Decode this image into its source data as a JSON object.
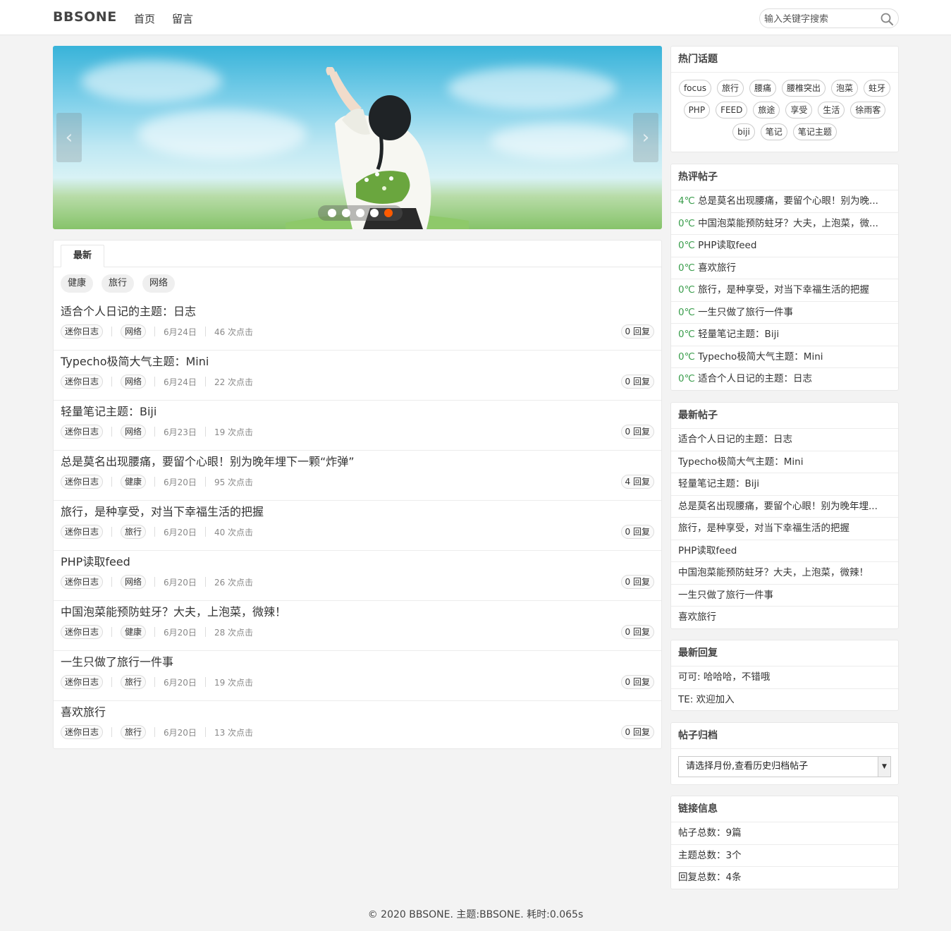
{
  "header": {
    "logo": "BBSONE",
    "nav": [
      "首页",
      "留言"
    ],
    "search_placeholder": "输入关键字搜索",
    "search_icon": "search-icon"
  },
  "banner": {
    "prev": "‹",
    "next": "›",
    "slide_count": 5,
    "active_slide": 5,
    "active_color": "#ff5a00"
  },
  "main": {
    "tab": "最新",
    "filters": [
      "健康",
      "旅行",
      "网络"
    ],
    "posts": [
      {
        "title": "适合个人日记的主题：日志",
        "forum": "迷你日志",
        "category": "网络",
        "date": "6月24日",
        "clicks": "46 次点击",
        "replies": "0 回复"
      },
      {
        "title": "Typecho极简大气主题：Mini",
        "forum": "迷你日志",
        "category": "网络",
        "date": "6月24日",
        "clicks": "22 次点击",
        "replies": "0 回复"
      },
      {
        "title": "轻量笔记主题：Biji",
        "forum": "迷你日志",
        "category": "网络",
        "date": "6月23日",
        "clicks": "19 次点击",
        "replies": "0 回复"
      },
      {
        "title": "总是莫名出现腰痛，要留个心眼！别为晚年埋下一颗“炸弹”",
        "forum": "迷你日志",
        "category": "健康",
        "date": "6月20日",
        "clicks": "95 次点击",
        "replies": "4 回复"
      },
      {
        "title": "旅行，是种享受，对当下幸福生活的把握",
        "forum": "迷你日志",
        "category": "旅行",
        "date": "6月20日",
        "clicks": "40 次点击",
        "replies": "0 回复"
      },
      {
        "title": "PHP读取feed",
        "forum": "迷你日志",
        "category": "网络",
        "date": "6月20日",
        "clicks": "26 次点击",
        "replies": "0 回复"
      },
      {
        "title": "中国泡菜能预防蛀牙？大夫，上泡菜，微辣！",
        "forum": "迷你日志",
        "category": "健康",
        "date": "6月20日",
        "clicks": "28 次点击",
        "replies": "0 回复"
      },
      {
        "title": "一生只做了旅行一件事",
        "forum": "迷你日志",
        "category": "旅行",
        "date": "6月20日",
        "clicks": "19 次点击",
        "replies": "0 回复"
      },
      {
        "title": "喜欢旅行",
        "forum": "迷你日志",
        "category": "旅行",
        "date": "6月20日",
        "clicks": "13 次点击",
        "replies": "0 回复"
      }
    ]
  },
  "sidebar": {
    "hot_topics": {
      "title": "热门话题",
      "tags": [
        "focus",
        "旅行",
        "腰痛",
        "腰椎突出",
        "泡菜",
        "蛀牙",
        "PHP",
        "FEED",
        "旅途",
        "享受",
        "生活",
        "徐雨客",
        "biji",
        "笔记",
        "笔记主题"
      ]
    },
    "hot_posts": {
      "title": "热评帖子",
      "items": [
        {
          "temp": "4℃",
          "text": "总是莫名出现腰痛，要留个心眼！别为晚..."
        },
        {
          "temp": "0℃",
          "text": "中国泡菜能预防蛀牙？大夫，上泡菜，微..."
        },
        {
          "temp": "0℃",
          "text": "PHP读取feed"
        },
        {
          "temp": "0℃",
          "text": "喜欢旅行"
        },
        {
          "temp": "0℃",
          "text": "旅行，是种享受，对当下幸福生活的把握"
        },
        {
          "temp": "0℃",
          "text": "一生只做了旅行一件事"
        },
        {
          "temp": "0℃",
          "text": "轻量笔记主题：Biji"
        },
        {
          "temp": "0℃",
          "text": "Typecho极简大气主题：Mini"
        },
        {
          "temp": "0℃",
          "text": "适合个人日记的主题：日志"
        }
      ]
    },
    "latest_posts": {
      "title": "最新帖子",
      "items": [
        "适合个人日记的主题：日志",
        "Typecho极简大气主题：Mini",
        "轻量笔记主题：Biji",
        "总是莫名出现腰痛，要留个心眼！别为晚年埋...",
        "旅行，是种享受，对当下幸福生活的把握",
        "PHP读取feed",
        "中国泡菜能预防蛀牙？大夫，上泡菜，微辣！",
        "一生只做了旅行一件事",
        "喜欢旅行"
      ]
    },
    "latest_replies": {
      "title": "最新回复",
      "items": [
        "可可: 哈哈哈，不错哦",
        "TE: 欢迎加入"
      ]
    },
    "archive": {
      "title": "帖子归档",
      "select_value": "请选择月份,查看历史归档帖子"
    },
    "stats": {
      "title": "链接信息",
      "items": [
        "帖子总数：9篇",
        "主题总数：3个",
        "回复总数：4条"
      ]
    }
  },
  "footer": {
    "text": "© 2020 BBSONE. 主题:BBSONE. 耗时:0.065s"
  }
}
